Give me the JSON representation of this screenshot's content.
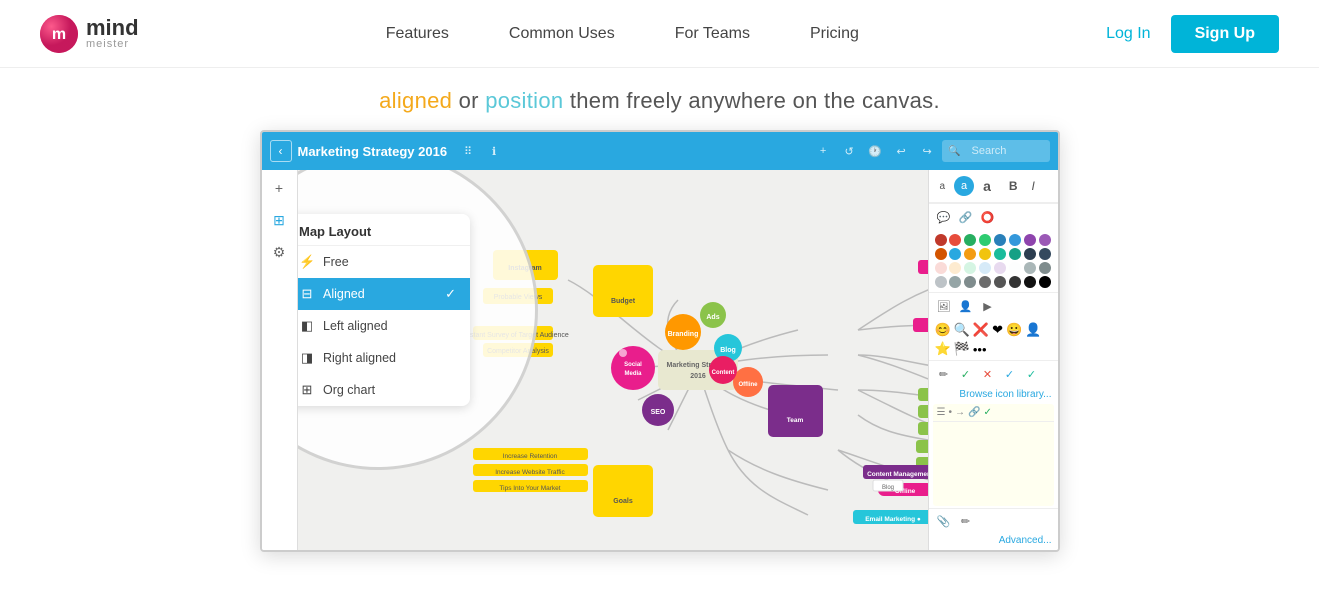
{
  "header": {
    "logo": {
      "mind": "mind",
      "meister": "meister"
    },
    "nav": [
      {
        "label": "Features",
        "id": "features"
      },
      {
        "label": "Common Uses",
        "id": "common-uses"
      },
      {
        "label": "For Teams",
        "id": "for-teams"
      },
      {
        "label": "Pricing",
        "id": "pricing"
      }
    ],
    "login_label": "Log In",
    "signup_label": "Sign Up"
  },
  "hero": {
    "text_part1": "aligned",
    "text_part2": " or ",
    "text_part3": "position",
    "text_part4": " them freely anywhere on the canvas."
  },
  "app": {
    "toolbar": {
      "title": "Marketing Strategy 2016",
      "search_placeholder": "Search"
    },
    "map_layout_popup": {
      "header": "Map Layout",
      "items": [
        {
          "icon": "⚡",
          "label": "Free",
          "active": false
        },
        {
          "icon": "⊟",
          "label": "Aligned",
          "active": true
        },
        {
          "icon": "◧",
          "label": "Left aligned",
          "active": false
        },
        {
          "icon": "◨",
          "label": "Right aligned",
          "active": false
        },
        {
          "icon": "⊞",
          "label": "Org chart",
          "active": false
        }
      ]
    },
    "canvas": {
      "central_node": "Marketing Strategy\n2016"
    },
    "right_panel": {
      "format_buttons": [
        "a",
        "a",
        "a",
        "B",
        "I"
      ],
      "browse_icon_library": "Browse icon library...",
      "advanced": "Advanced..."
    }
  },
  "colors": {
    "primary": "#29a8e0",
    "accent_or": "#f4a91c",
    "accent_pos": "#5bc8d8",
    "signup_bg": "#00b4d8"
  }
}
